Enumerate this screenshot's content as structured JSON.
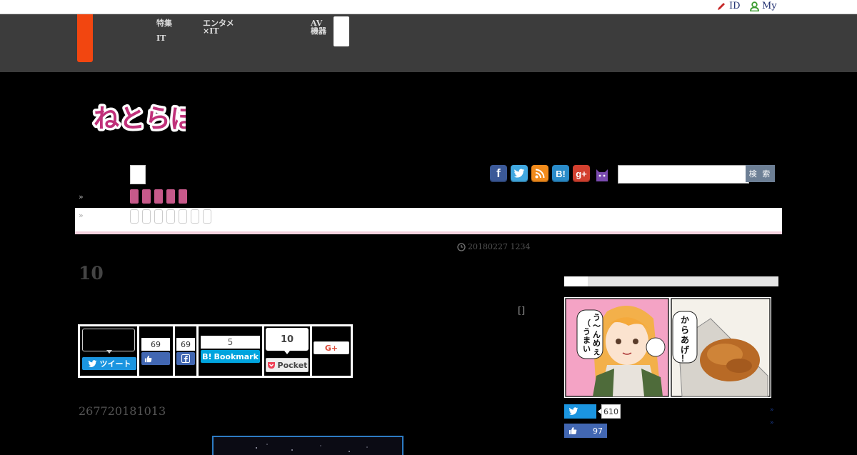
{
  "topbar": {
    "id_link": "ID",
    "my_link": "My"
  },
  "header": {
    "nav": [
      {
        "line1": "特集",
        "line2": "IT"
      },
      {
        "line1": "エンタメ",
        "line2": "×IT"
      },
      {
        "line1": "AV",
        "line2": "機器"
      }
    ]
  },
  "logo": {
    "text": "ねとらぼ"
  },
  "search": {
    "placeholder": "",
    "button_label": "検 索"
  },
  "social_icons": [
    "facebook-icon",
    "twitter-icon",
    "rss-icon",
    "hatena-bookmark-icon",
    "google-plus-icon",
    "cat-icon"
  ],
  "breadcrumb": {
    "marker_1": "»",
    "marker_2": "»"
  },
  "article": {
    "date": "20180227 1234",
    "title": "10",
    "bracket": "[]",
    "lead": "267720181013"
  },
  "share": {
    "tweet_label": "ツイート",
    "like_count": "69",
    "fb_share_count": "69",
    "hatena_count": "5",
    "hatena_label": "Bookmark",
    "pocket_count": "10",
    "pocket_label": "Pocket",
    "gplus_label": "G+"
  },
  "sidebar": {
    "manga": {
      "speech_left": "う〜んめぇ！（うまい）",
      "speech_right": "からあげ！"
    },
    "twitter_count": "610",
    "facebook_count": "97",
    "arrow_1": "»",
    "arrow_2": "»"
  },
  "colors": {
    "accent_orange": "#f24610",
    "logo_pink": "#c0317a",
    "pink_tab": "#c7598a",
    "twitter_blue": "#1b95e0",
    "facebook_blue": "#4267b2",
    "hatena_blue": "#00a4de",
    "pocket_red": "#ef4056"
  }
}
